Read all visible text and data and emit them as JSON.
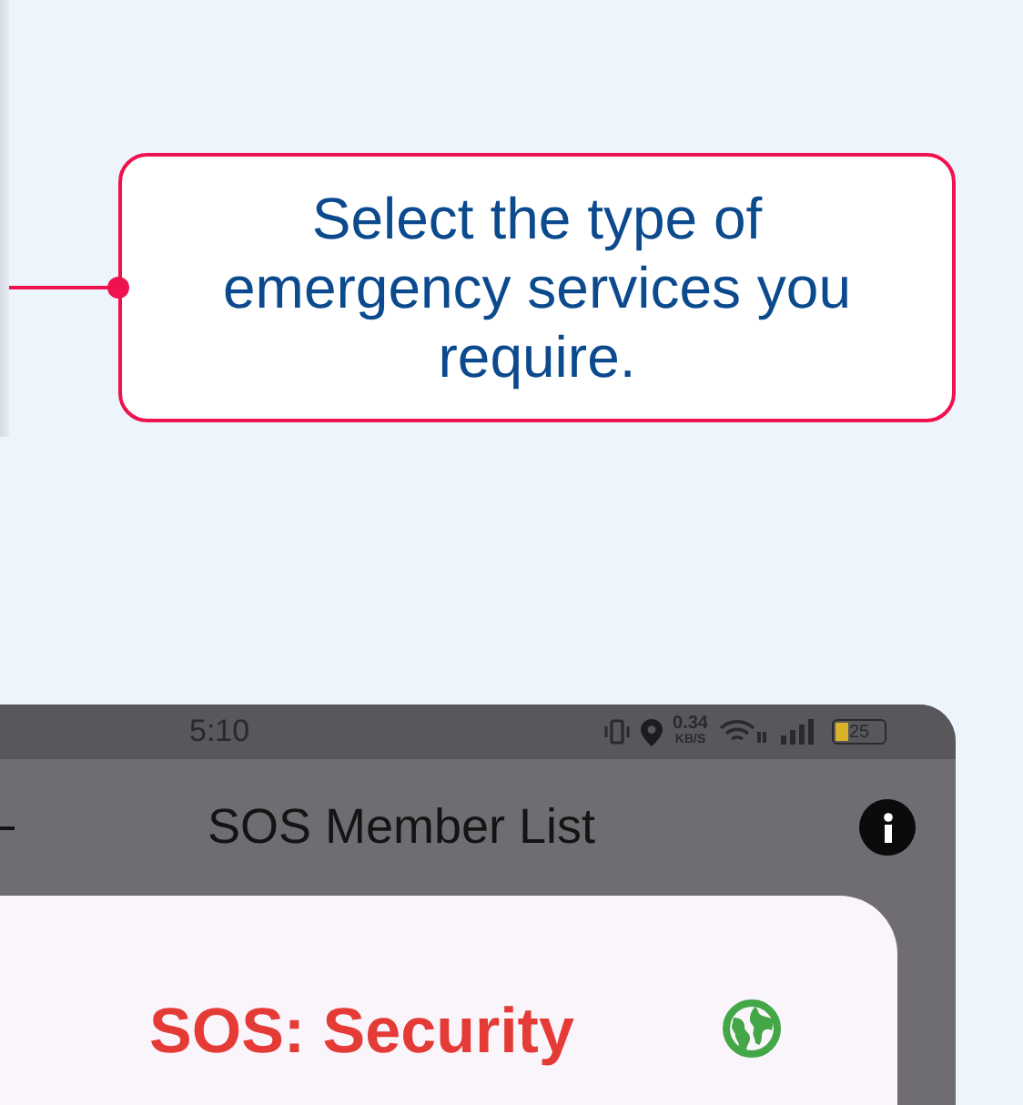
{
  "callout": {
    "text": "Select the type of emergency services you require."
  },
  "phone": {
    "status_bar": {
      "time": "5:10",
      "net_speed": "0.34",
      "net_speed_unit": "KB/S",
      "battery": "25"
    },
    "app_bar": {
      "title": "SOS Member List"
    },
    "dialog": {
      "title": "SOS: Security"
    }
  }
}
